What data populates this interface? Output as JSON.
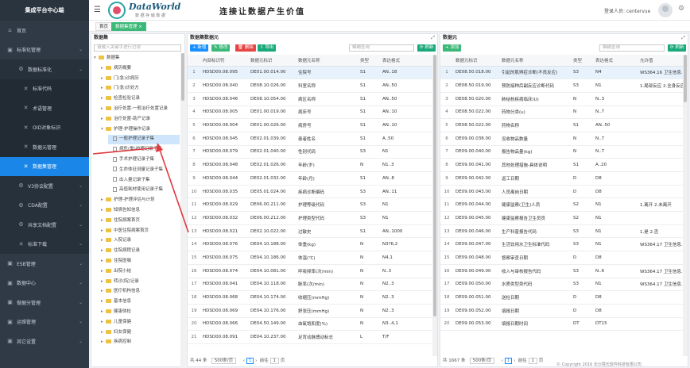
{
  "sidebar": {
    "title": "集成平台中心端",
    "items": [
      {
        "label": "首页",
        "icon": "home-icon",
        "level": 0,
        "expandable": false
      },
      {
        "label": "标准化管理",
        "icon": "monitor-icon",
        "level": 0,
        "expandable": true
      },
      {
        "label": "数据标准化",
        "icon": "gear-icon",
        "level": 1,
        "expandable": true
      },
      {
        "label": "标准代码",
        "icon": "tools-icon",
        "level": 2,
        "expandable": false
      },
      {
        "label": "术语管理",
        "icon": "tools-icon",
        "level": 2,
        "expandable": false
      },
      {
        "label": "OID对象标识",
        "icon": "tools-icon",
        "level": 2,
        "expandable": false
      },
      {
        "label": "数据元管理",
        "icon": "tools-icon",
        "level": 2,
        "expandable": false
      },
      {
        "label": "数据集管理",
        "icon": "tools-icon",
        "level": 2,
        "expandable": false,
        "active": true
      },
      {
        "label": "V3协议配置",
        "icon": "gear-icon",
        "level": 1,
        "expandable": true
      },
      {
        "label": "CDA配置",
        "icon": "gear-icon",
        "level": 1,
        "expandable": true
      },
      {
        "label": "共享文档配置",
        "icon": "gear-icon",
        "level": 1,
        "expandable": true
      },
      {
        "label": "标准下载",
        "icon": "tools-icon",
        "level": 1,
        "expandable": true
      },
      {
        "label": "ESB管理",
        "icon": "monitor-icon",
        "level": 0,
        "expandable": true
      },
      {
        "label": "数据中心",
        "icon": "monitor-icon",
        "level": 0,
        "expandable": true
      },
      {
        "label": "做据分管理",
        "icon": "monitor-icon",
        "level": 0,
        "expandable": true
      },
      {
        "label": "运维管理",
        "icon": "monitor-icon",
        "level": 0,
        "expandable": true
      },
      {
        "label": "其它设置",
        "icon": "monitor-icon",
        "level": 0,
        "expandable": true
      }
    ]
  },
  "header": {
    "brand_name": "DataWorld",
    "brand_sub": "数 据 存 储 数 据",
    "slogan": "连接让数据产生价值",
    "login_label": "登录人员:",
    "login_user": "centervue"
  },
  "tabs": [
    {
      "label": "首页",
      "active": false
    },
    {
      "label": "数据集管理 ×",
      "active": true
    }
  ],
  "dataset_panel": {
    "title": "数据集",
    "search_placeholder": "请输入关键字进行过滤",
    "tree": [
      {
        "label": "数据集",
        "level": 0,
        "type": "folder",
        "open": true
      },
      {
        "label": "病历概要",
        "level": 1,
        "type": "folder"
      },
      {
        "label": "门(急)诊病历",
        "level": 1,
        "type": "folder"
      },
      {
        "label": "门(急)诊处方",
        "level": 1,
        "type": "folder"
      },
      {
        "label": "检查检验记录",
        "level": 1,
        "type": "folder"
      },
      {
        "label": "治疗处置-一般治疗处置记录",
        "level": 1,
        "type": "folder"
      },
      {
        "label": "治疗处置-助产记录",
        "level": 1,
        "type": "folder"
      },
      {
        "label": "护理-护理操作记录",
        "level": 1,
        "type": "folder",
        "open": true
      },
      {
        "label": "一般护理记录子集",
        "level": 2,
        "type": "doc",
        "selected": true
      },
      {
        "label": "病危(重)护理记录子集",
        "level": 2,
        "type": "doc"
      },
      {
        "label": "手术护理记录子集",
        "level": 2,
        "type": "doc"
      },
      {
        "label": "生命体征测量记录子集",
        "level": 2,
        "type": "doc"
      },
      {
        "label": "出入量记录子集",
        "level": 2,
        "type": "doc"
      },
      {
        "label": "高值耗材使用记录子集",
        "level": 2,
        "type": "doc"
      },
      {
        "label": "护理-护理评估与计划",
        "level": 1,
        "type": "folder"
      },
      {
        "label": "知情告知信息",
        "level": 1,
        "type": "folder"
      },
      {
        "label": "住院病案首页",
        "level": 1,
        "type": "folder"
      },
      {
        "label": "中医住院病案首页",
        "level": 1,
        "type": "folder"
      },
      {
        "label": "入院记录",
        "level": 1,
        "type": "folder"
      },
      {
        "label": "住院病程记录",
        "level": 1,
        "type": "folder"
      },
      {
        "label": "住院医嘱",
        "level": 1,
        "type": "folder"
      },
      {
        "label": "出院小结",
        "level": 1,
        "type": "folder"
      },
      {
        "label": "转诊(院)记录",
        "level": 1,
        "type": "folder"
      },
      {
        "label": "医疗机构信息",
        "level": 1,
        "type": "folder"
      },
      {
        "label": "基本信息",
        "level": 1,
        "type": "folder"
      },
      {
        "label": "健康体检",
        "level": 1,
        "type": "folder"
      },
      {
        "label": "儿童保健",
        "level": 1,
        "type": "folder"
      },
      {
        "label": "妇女保健",
        "level": 1,
        "type": "folder"
      },
      {
        "label": "疾病控制",
        "level": 1,
        "type": "folder"
      }
    ]
  },
  "elements_panel": {
    "title": "数据集数据元",
    "buttons": {
      "add": "新增",
      "edit": "修改",
      "delete": "删除",
      "export": "导出",
      "refresh": "刷新"
    },
    "search_placeholder": "模糊查询",
    "columns": [
      "",
      "内部标识符",
      "数据元标识",
      "数据元名称",
      "类型",
      "表达格式"
    ],
    "rows": [
      [
        "1",
        "HDSD00.08.095",
        "DE01.00.014.00",
        "住院号",
        "S1",
        "AN..18"
      ],
      [
        "2",
        "HDSD00.08.040",
        "DE08.10.026.00",
        "科室名称",
        "S1",
        "AN..50"
      ],
      [
        "3",
        "HDSD00.08.046",
        "DE08.10.054.00",
        "病区名称",
        "S1",
        "AN..50"
      ],
      [
        "4",
        "HDSD00.08.005",
        "DE01.00.019.00",
        "病床号",
        "S1",
        "AN..10"
      ],
      [
        "5",
        "HDSD00.08.004",
        "DE01.00.026.00",
        "病房号",
        "S1",
        "AN..10"
      ],
      [
        "6",
        "HDSD00.08.045",
        "DE02.01.039.00",
        "患者姓名",
        "S1",
        "A..50"
      ],
      [
        "7",
        "HDSD00.08.079",
        "DE02.01.040.00",
        "性别代码",
        "S3",
        "N1"
      ],
      [
        "8",
        "HDSD00.08.048",
        "DE02.01.026.00",
        "年龄(岁)",
        "N",
        "N1..3"
      ],
      [
        "9",
        "HDSD00.08.044",
        "DE02.01.032.00",
        "年龄(月)",
        "S1",
        "AN..8"
      ],
      [
        "10",
        "HDSD00.08.035",
        "DE05.01.024.00",
        "疾病诊断编码",
        "S3",
        "AN..11"
      ],
      [
        "11",
        "HDSD00.08.029",
        "DE06.00.211.00",
        "护理等级代码",
        "S3",
        "N1"
      ],
      [
        "12",
        "HDSD00.08.032",
        "DE06.00.212.00",
        "护理类型代码",
        "S3",
        "N1"
      ],
      [
        "13",
        "HDSD00.08.021",
        "DE02.10.022.00",
        "过敏史",
        "S1",
        "AN..1000"
      ],
      [
        "14",
        "HDSD00.08.076",
        "DE04.10.188.00",
        "体重(kg)",
        "N",
        "N3?6,2"
      ],
      [
        "15",
        "HDSD00.08.075",
        "DE04.10.186.00",
        "体温(℃)",
        "N",
        "N4,1"
      ],
      [
        "16",
        "HDSD00.08.074",
        "DE04.10.081.00",
        "呼吸频率(次/min)",
        "N",
        "N..3"
      ],
      [
        "17",
        "HDSD00.08.041",
        "DE04.10.118.00",
        "脉率(次/min)",
        "N",
        "N2..3"
      ],
      [
        "18",
        "HDSD00.08.068",
        "DE04.10.174.00",
        "收缩压(mmHg)",
        "N",
        "N2..3"
      ],
      [
        "19",
        "HDSD00.08.069",
        "DE04.10.176.00",
        "舒张压(mmHg)",
        "N",
        "N2..3"
      ],
      [
        "20",
        "HDSD00.08.066",
        "DE04.50.149.00",
        "血氧饱和度(%)",
        "N",
        "N3..4,1"
      ],
      [
        "21",
        "HDSD00.08.091",
        "DE04.10.237.00",
        "足背动脉搏动标志",
        "L",
        "T/F"
      ]
    ],
    "footer": {
      "total": "共 44 条",
      "page_size": "500条/页",
      "prev": "前往",
      "page": "1",
      "unit": "页"
    }
  },
  "dataelem_panel": {
    "title": "数据元",
    "buttons": {
      "add": "添加",
      "refresh": "刷新"
    },
    "search_placeholder": "模糊查询",
    "columns": [
      "",
      "数据元标识",
      "数据元名称",
      "类型",
      "表达格式",
      "允许值"
    ],
    "rows": [
      [
        "1",
        "DE08.50.018.00",
        "引起的肌辨症诊断(不良反应)",
        "S3",
        "N4",
        "WS364.16 卫生信息..."
      ],
      [
        "2",
        "DE08.50.019.00",
        "预防接种后副反应诊断代码",
        "S3",
        "N1",
        "1.局部反应 2.全身反应"
      ],
      [
        "3",
        "DE08.50.020.00",
        "肺结核疾病临床(U)",
        "N",
        "N..3",
        ""
      ],
      [
        "4",
        "DE08.50.022.00",
        "药物分类(u)",
        "N",
        "N..7",
        ""
      ],
      [
        "5",
        "DE08.50.022.00",
        "药物名称",
        "S1",
        "AN..50",
        ""
      ],
      [
        "6",
        "DE09.00.038.00",
        "没收物品数量",
        "N",
        "N..7",
        ""
      ],
      [
        "7",
        "DE09.00.040.00",
        "报告物品量(kg)",
        "N",
        "N..7",
        ""
      ],
      [
        "8",
        "DE09.00.041.00",
        "其他处理措施-具体说明",
        "S1",
        "A..20",
        ""
      ],
      [
        "9",
        "DE09.00.042.00",
        "返工日期",
        "D",
        "D8",
        ""
      ],
      [
        "10",
        "DE09.00.043.00",
        "人员离岗日期",
        "D",
        "D8",
        ""
      ],
      [
        "11",
        "DE09.00.044.00",
        "健康监察(卫生)人员",
        "S2",
        "N1",
        "1.离开 2.未离开"
      ],
      [
        "12",
        "DE09.00.045.00",
        "健康监察报告卫生员员",
        "S2",
        "N1",
        ""
      ],
      [
        "13",
        "DE09.00.046.00",
        "生产科普报告代码",
        "S3",
        "N1",
        "1.是 2.否"
      ],
      [
        "14",
        "DE09.00.047.00",
        "生活饮用水卫生标准代码",
        "S3",
        "N1",
        "WS364.17 卫生信息..."
      ],
      [
        "15",
        "DE09.00.048.00",
        "督察审查日期",
        "D",
        "D8",
        ""
      ],
      [
        "16",
        "DE09.00.049.00",
        "收入与审核报告代码",
        "S3",
        "N..6",
        "WS364.17 卫生信息..."
      ],
      [
        "17",
        "DE09.00.050.00",
        "水质类型类代码",
        "S3",
        "N1",
        "WS364.17 卫生信息..."
      ],
      [
        "18",
        "DE09.00.051.00",
        "送检日期",
        "D",
        "D8",
        ""
      ],
      [
        "19",
        "DE09.00.052.00",
        "填报日期",
        "D",
        "D8",
        ""
      ],
      [
        "20",
        "DE09.00.053.00",
        "填报日期时间",
        "DT",
        "DT15",
        ""
      ]
    ],
    "footer": {
      "total": "共 1667 条",
      "page_size": "500条/页",
      "prev": "前往",
      "page": "1",
      "unit": "页"
    }
  },
  "copyright": "© Copyright 2016 长沙慧氏软件科技有限公司",
  "colors": {
    "sidebar_bg": "#2f3a46",
    "active": "#1a86e8",
    "accent_green": "#3cb878",
    "danger": "#e64545"
  }
}
